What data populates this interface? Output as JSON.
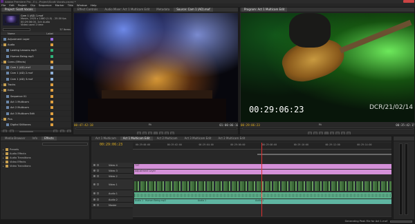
{
  "title": "Adobe Premiere Pro - E:\\...Project\\Scott Vocals.prproj *",
  "menu": [
    "File",
    "Edit",
    "Project",
    "Clip",
    "Sequence",
    "Marker",
    "Title",
    "Window",
    "Help"
  ],
  "project": {
    "tab": "Project: Scott Vocals",
    "clip_name": "Cam 1 (AD) 1.mxf",
    "clip_info": [
      "Movie, 1920 x 1080 (1.0) - 25.00 fps",
      "00:29:06:00, 2ch Audio",
      "Video used 1 time"
    ],
    "item_count": "37 Items",
    "col_name": "Name",
    "col_label": "Label",
    "items": [
      {
        "name": "Adjustment Layer",
        "color": "#9a6be0",
        "indent": 1,
        "folder": false
      },
      {
        "name": "Audio",
        "color": "#e0a040",
        "indent": 1,
        "folder": true
      },
      {
        "name": "Lasting Lessons.mp3",
        "color": "#2fb37a",
        "indent": 2,
        "folder": false
      },
      {
        "name": "Human Being.mp3",
        "color": "#2fb37a",
        "indent": 2,
        "folder": false
      },
      {
        "name": "Cams (Effects)",
        "color": "#e0a040",
        "indent": 1,
        "folder": true
      },
      {
        "name": "Cam 1 (AD).mxf",
        "color": "#8fb0d8",
        "indent": 2,
        "folder": false
      },
      {
        "name": "Cam 1 (AD) 2.mxf",
        "color": "#8fb0d8",
        "indent": 2,
        "folder": false
      },
      {
        "name": "Cam 1 (AD) 3.mxf",
        "color": "#8fb0d8",
        "indent": 2,
        "folder": false
      },
      {
        "name": "Tracks",
        "color": "#e0a040",
        "indent": 1,
        "folder": true
      },
      {
        "name": "Edits",
        "color": "#e0a040",
        "indent": 1,
        "folder": true
      },
      {
        "name": "Sequence 01",
        "color": "#e0a040",
        "indent": 2,
        "folder": false
      },
      {
        "name": "Act 1 Multicam",
        "color": "#e0a040",
        "indent": 2,
        "folder": false
      },
      {
        "name": "Act 2 Multicam",
        "color": "#e0a040",
        "indent": 2,
        "folder": false
      },
      {
        "name": "Act 3 Multicam Edit",
        "color": "#e0a040",
        "indent": 2,
        "folder": false
      },
      {
        "name": "Pics",
        "color": "#e0a040",
        "indent": 1,
        "folder": true
      },
      {
        "name": "Digital Stilltones",
        "color": "#e0a040",
        "indent": 2,
        "folder": false
      }
    ]
  },
  "effects": {
    "tabs": [
      "Media Browser",
      "Info",
      "Effects"
    ],
    "items": [
      "Presets",
      "Audio Effects",
      "Audio Transitions",
      "Video Effects",
      "Video Transitions"
    ]
  },
  "source": {
    "tabs": [
      "Effect Controls",
      "Audio Mixer: Act 1 Multicam Edit",
      "Metadata",
      "Source: Cam 1 (AD).mxf"
    ],
    "timecode_left": "00:47:42:18",
    "fit": "Fit",
    "timecode_right": "01:00:06:10"
  },
  "program": {
    "tab": "Program: Act 1 Multicam Edit",
    "overlay_timecode": "00:29:06:23",
    "overlay_date": "DCR/21/02/14",
    "timecode_left": "00:29:06:23",
    "fit": "Fit",
    "timecode_right": "00:35:42:15"
  },
  "timeline": {
    "tabs": [
      "Act 1 Multicam",
      "Act 1 Multicam Edit",
      "Act 2 Multicam",
      "Act 3 Multicam Edit",
      "Act 2 Multicam Edit"
    ],
    "timecode": "00:29:06:23",
    "ruler": [
      "00:29:00:00",
      "00:29:02:00",
      "00:29:04:00",
      "00:29:06:00",
      "00:29:08:00",
      "00:29:10:00",
      "00:29:12:00",
      "00:29:14:00"
    ],
    "tracks": [
      {
        "label": "Video 4",
        "kind": "video"
      },
      {
        "label": "Video 3",
        "kind": "video"
      },
      {
        "label": "Video 2",
        "kind": "video"
      },
      {
        "label": "Video 1",
        "kind": "video"
      },
      {
        "label": "Audio 1",
        "kind": "audio"
      },
      {
        "label": "Audio 2",
        "kind": "audio"
      },
      {
        "label": "Master",
        "kind": "audio"
      }
    ],
    "clip_v4": "TXT",
    "clip_v3": "Adjustment Layer",
    "clip_a1_a": "Audio 1",
    "clip_a1_b": "Human Being.mp3",
    "clip_a1_c": "Audio 1",
    "clip_a1_d": "Audio 1"
  },
  "status": "Generating Peak File for Act 1.mxf"
}
